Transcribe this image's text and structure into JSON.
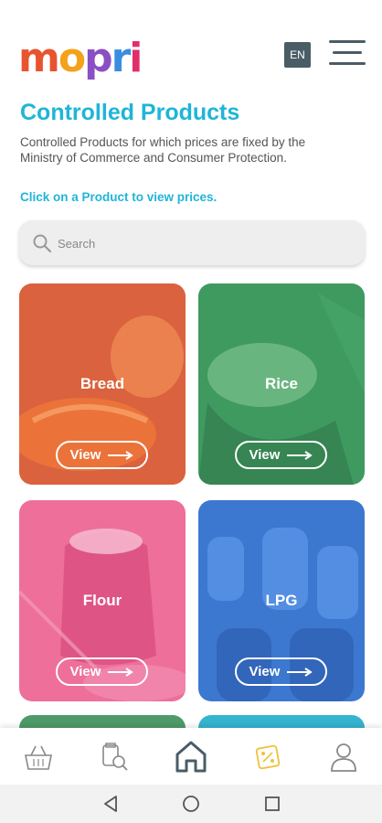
{
  "header": {
    "logo_text": "mopri",
    "language_label": "EN"
  },
  "page": {
    "title": "Controlled Products",
    "description": "Controlled Products for which prices are fixed by the Ministry of Commerce and Consumer Protection.",
    "hint": "Click on a Product to view prices."
  },
  "search": {
    "placeholder": "Search",
    "value": ""
  },
  "products": [
    {
      "name": "Bread",
      "button": "View",
      "tint": "#e06a45"
    },
    {
      "name": "Rice",
      "button": "View",
      "tint": "#3f9a60"
    },
    {
      "name": "Flour",
      "button": "View",
      "tint": "#ee6f9a"
    },
    {
      "name": "LPG",
      "button": "View",
      "tint": "#3d78d0"
    }
  ],
  "bottom_nav": [
    "basket-icon",
    "price-search-icon",
    "home-icon",
    "promotions-icon",
    "profile-icon"
  ],
  "colors": {
    "accent": "#1fb5d8",
    "header_icon": "#4a5d66",
    "active_nav": "#4a5d66",
    "promo_nav": "#f0c23a"
  }
}
